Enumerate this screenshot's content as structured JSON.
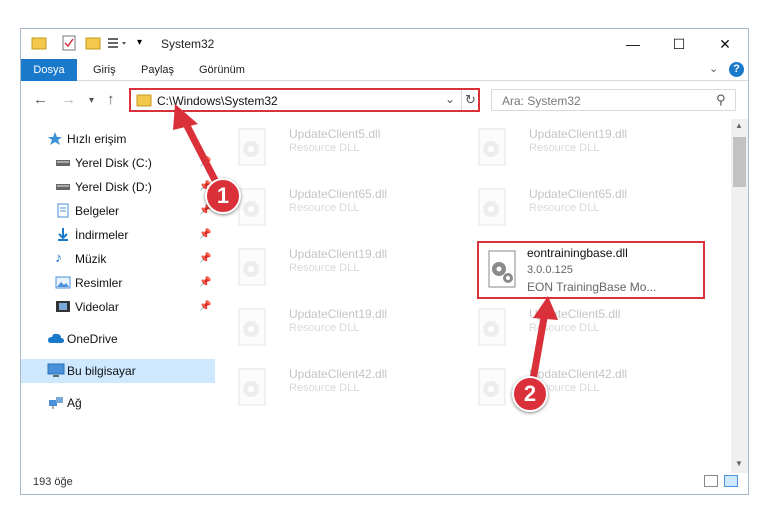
{
  "window": {
    "title": "System32",
    "controls": {
      "minimize": "—",
      "maximize": "☐",
      "close": "✕"
    }
  },
  "ribbon": {
    "tabs": [
      "Dosya",
      "Giriş",
      "Paylaş",
      "Görünüm"
    ],
    "help_icon": "?"
  },
  "nav": {
    "address": "C:\\Windows\\System32",
    "search_placeholder": "Ara: System32"
  },
  "sidebar": {
    "items": [
      {
        "label": "Hızlı erişim",
        "icon": "star-icon"
      },
      {
        "label": "Yerel Disk (C:)",
        "icon": "drive-icon"
      },
      {
        "label": "Yerel Disk (D:)",
        "icon": "drive-icon"
      },
      {
        "label": "Belgeler",
        "icon": "documents-icon"
      },
      {
        "label": "İndirmeler",
        "icon": "download-icon"
      },
      {
        "label": "Müzik",
        "icon": "music-icon"
      },
      {
        "label": "Resimler",
        "icon": "pictures-icon"
      },
      {
        "label": "Videolar",
        "icon": "videos-icon"
      },
      {
        "label": "OneDrive",
        "icon": "cloud-icon"
      },
      {
        "label": "Bu bilgisayar",
        "icon": "computer-icon"
      },
      {
        "label": "Ağ",
        "icon": "network-icon"
      }
    ]
  },
  "files": [
    {
      "name": "UpdateClient5.dll",
      "line2": "Resource DLL",
      "line3": ""
    },
    {
      "name": "UpdateClient19.dll",
      "line2": "Resource DLL",
      "line3": ""
    },
    {
      "name": "UpdateClient65.dll",
      "line2": "Resource DLL",
      "line3": ""
    },
    {
      "name": "UpdateClient65.dll",
      "line2": "Resource DLL",
      "line3": ""
    },
    {
      "name": "UpdateClient19.dll",
      "line2": "Resource DLL",
      "line3": ""
    },
    {
      "name": "eontrainingbase.dll",
      "line2": "3.0.0.125",
      "line3": "EON TrainingBase Mo..."
    },
    {
      "name": "UpdateClient19.dll",
      "line2": "Resource DLL",
      "line3": ""
    },
    {
      "name": "UpdateClient5.dll",
      "line2": "Resource DLL",
      "line3": ""
    },
    {
      "name": "UpdateClient42.dll",
      "line2": "Resource DLL",
      "line3": ""
    },
    {
      "name": "UpdateClient42.dll",
      "line2": "Resource DLL",
      "line3": ""
    }
  ],
  "status": {
    "count": "193 öğe"
  },
  "annotations": {
    "step1": "1",
    "step2": "2"
  },
  "colors": {
    "accent": "#1979ca",
    "highlight": "#d9303a",
    "selected": "#cde8ff"
  }
}
